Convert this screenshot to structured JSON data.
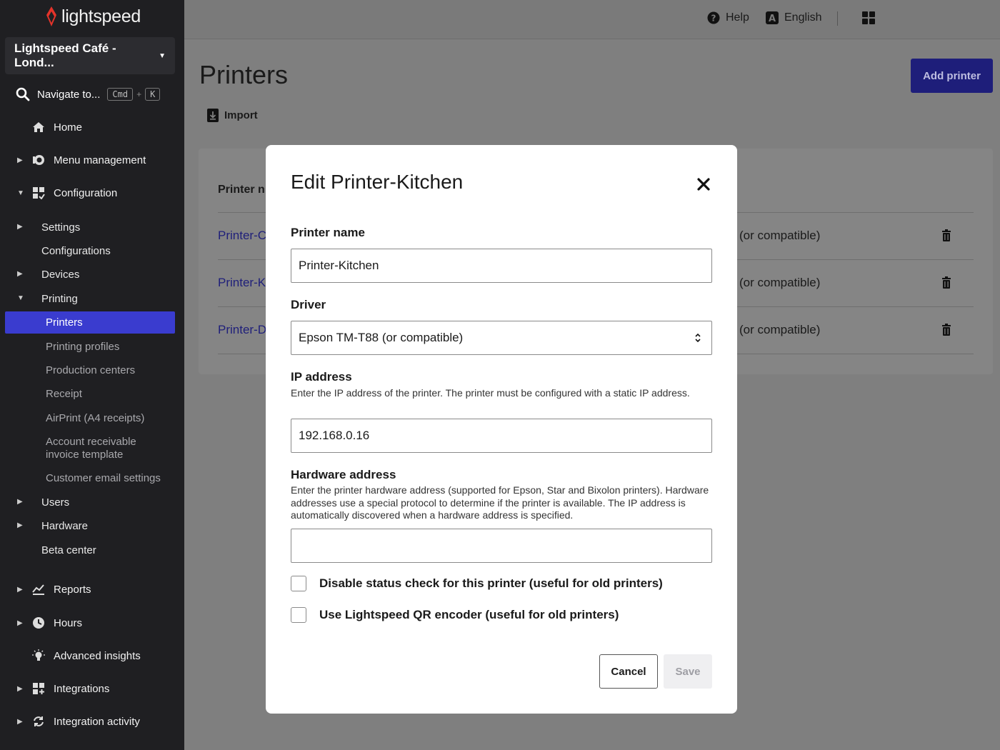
{
  "brand": {
    "name": "lightspeed"
  },
  "sidebar": {
    "location": "Lightspeed Café - Lond...",
    "navigate": {
      "label": "Navigate to...",
      "key1": "Cmd",
      "plus": "+",
      "key2": "K"
    },
    "items": [
      {
        "label": "Home",
        "icon": "home-icon"
      },
      {
        "label": "Menu management",
        "icon": "menu-management-icon"
      },
      {
        "label": "Configuration",
        "icon": "configuration-icon"
      },
      {
        "label": "Reports",
        "icon": "reports-icon"
      },
      {
        "label": "Hours",
        "icon": "clock-icon"
      },
      {
        "label": "Advanced insights",
        "icon": "lightbulb-icon"
      },
      {
        "label": "Integrations",
        "icon": "integrations-icon"
      },
      {
        "label": "Integration activity",
        "icon": "sync-icon"
      }
    ],
    "config_sub": [
      {
        "label": "Settings"
      },
      {
        "label": "Configurations"
      },
      {
        "label": "Devices"
      },
      {
        "label": "Printing"
      },
      {
        "label": "Users"
      },
      {
        "label": "Hardware"
      },
      {
        "label": "Beta center"
      }
    ],
    "printing_sub": [
      {
        "label": "Printers"
      },
      {
        "label": "Printing profiles"
      },
      {
        "label": "Production centers"
      },
      {
        "label": "Receipt"
      },
      {
        "label": "AirPrint (A4 receipts)"
      },
      {
        "label": "Account receivable invoice template"
      },
      {
        "label": "Customer email settings"
      }
    ]
  },
  "topbar": {
    "help": "Help",
    "language": "English"
  },
  "main": {
    "title": "Printers",
    "add_button": "Add printer",
    "import": "Import",
    "table_header": "Printer n",
    "rows": [
      {
        "name": "Printer-C",
        "driver": "(or compatible)"
      },
      {
        "name": "Printer-K",
        "driver": "(or compatible)"
      },
      {
        "name": "Printer-D",
        "driver": "(or compatible)"
      }
    ]
  },
  "modal": {
    "title": "Edit Printer-Kitchen",
    "printer_name_label": "Printer name",
    "printer_name_value": "Printer-Kitchen",
    "driver_label": "Driver",
    "driver_value": "Epson TM-T88 (or compatible)",
    "ip_label": "IP address",
    "ip_help": "Enter the IP address of the printer. The printer must be configured with a static IP address.",
    "ip_value": "192.168.0.16",
    "hw_label": "Hardware address",
    "hw_help": "Enter the printer hardware address (supported for Epson, Star and Bixolon printers). Hardware addresses use a special protocol to determine if the printer is available. The IP address is automatically discovered when a hardware address is specified.",
    "hw_value": "",
    "check_disable": "Disable status check for this printer (useful for old printers)",
    "check_qr": "Use Lightspeed QR encoder (useful for old printers)",
    "cancel": "Cancel",
    "save": "Save"
  },
  "colors": {
    "accent": "#3a3ccf",
    "sidebar_bg": "#1f1f22",
    "link": "#3a3ccf"
  }
}
